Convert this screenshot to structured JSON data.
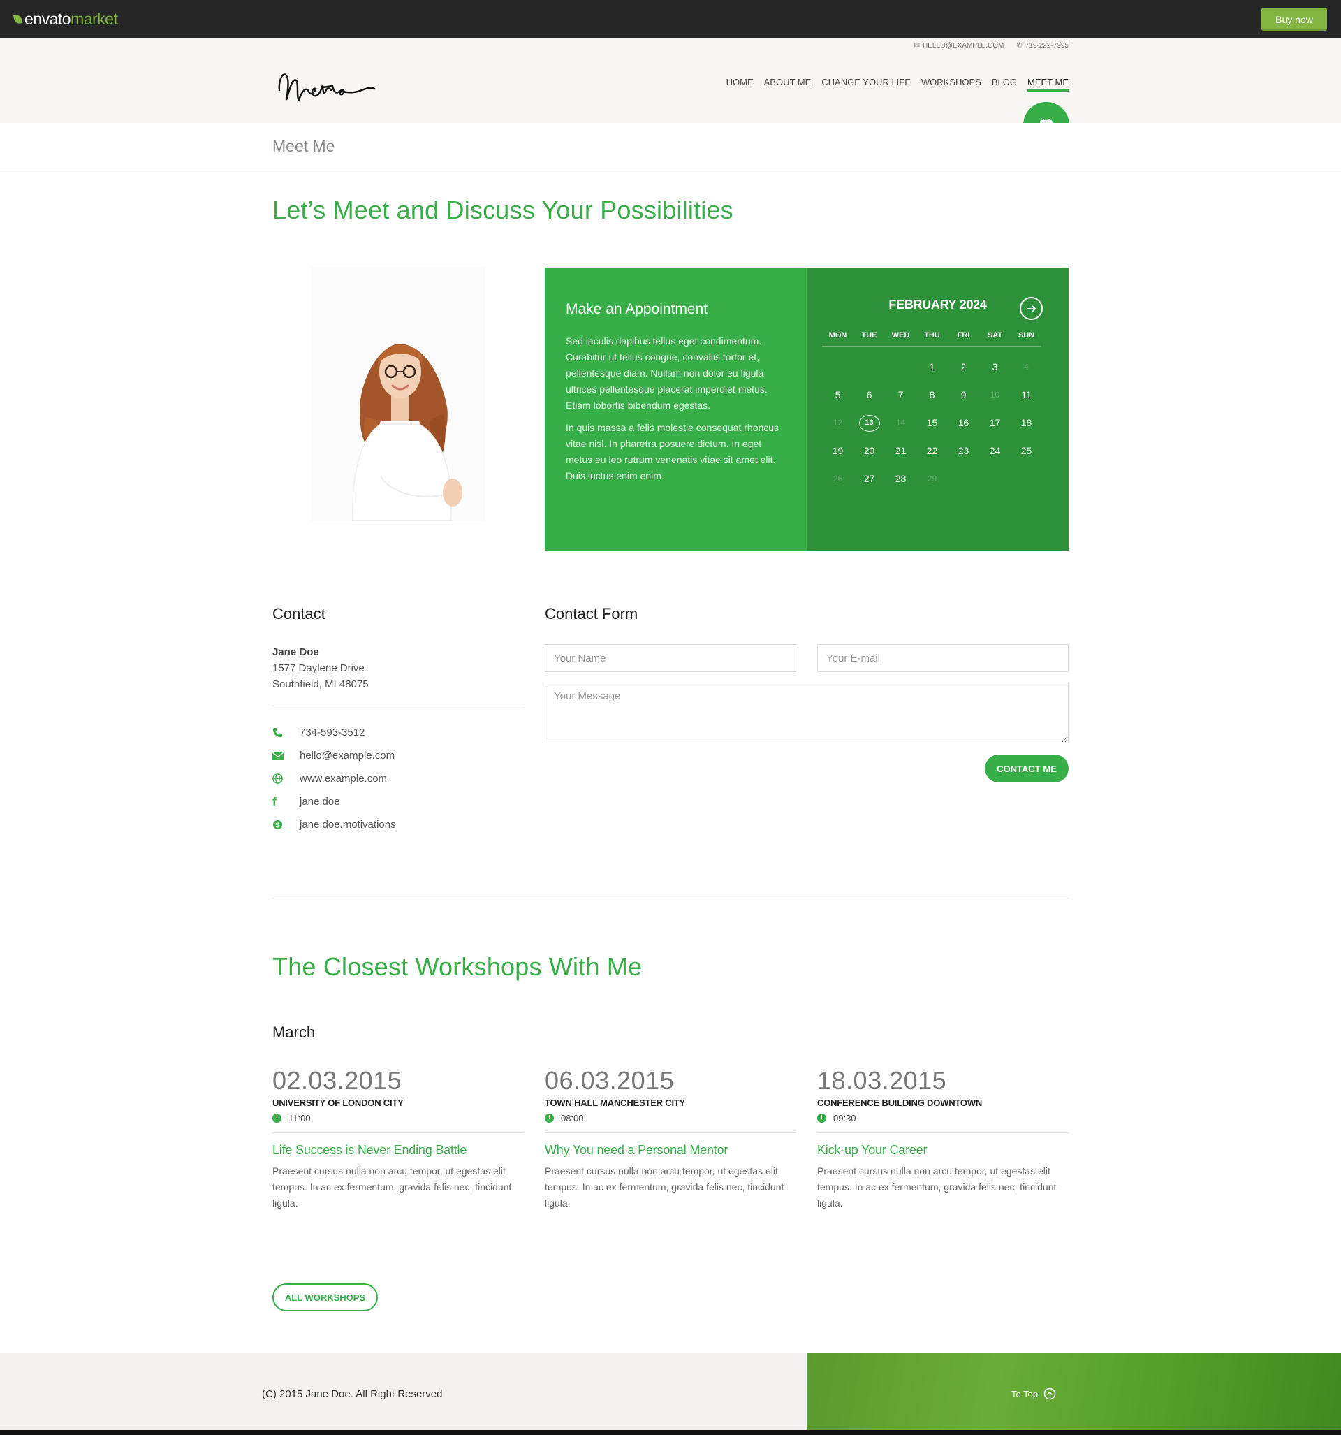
{
  "envato": {
    "logo_main": "envato",
    "logo_sub": "market",
    "buy_now": "Buy now"
  },
  "header": {
    "email": "HELLO@EXAMPLE.COM",
    "phone": "719-222-7995",
    "nav": [
      "HOME",
      "ABOUT ME",
      "CHANGE YOUR LIFE",
      "WORKSHOPS",
      "BLOG",
      "MEET ME"
    ],
    "active_nav": "MEET ME"
  },
  "page_title": "Meet Me",
  "intro_heading": "Let’s Meet and Discuss Your Possibilities",
  "appointment": {
    "title": "Make an Appointment",
    "paragraphs": [
      "Sed iaculis dapibus tellus eget condimentum. Curabitur ut tellus congue, convallis tortor et, pellentesque diam. Nullam non dolor eu ligula ultrices pellentesque placerat imperdiet metus. Etiam lobortis bibendum egestas.",
      "In quis massa a felis molestie consequat rhoncus vitae nisl. In pharetra posuere dictum. In eget metus eu leo rutrum venenatis vitae sit amet elit. Duis luctus enim enim."
    ]
  },
  "calendar": {
    "month": "FEBRUARY 2024",
    "weekdays": [
      "MON",
      "TUE",
      "WED",
      "THU",
      "FRI",
      "SAT",
      "SUN"
    ],
    "weeks": [
      [
        "",
        "",
        "",
        "1",
        "2",
        "3",
        "4"
      ],
      [
        "5",
        "6",
        "7",
        "8",
        "9",
        "10",
        "11"
      ],
      [
        "12",
        "13",
        "14",
        "15",
        "16",
        "17",
        "18"
      ],
      [
        "19",
        "20",
        "21",
        "22",
        "23",
        "24",
        "25"
      ],
      [
        "26",
        "27",
        "28",
        "29",
        "",
        "",
        ""
      ]
    ],
    "dimmed": [
      "4",
      "10",
      "12",
      "14",
      "26",
      "29"
    ],
    "today": "13"
  },
  "contact": {
    "heading": "Contact",
    "name": "Jane Doe",
    "address_line1": "1577 Daylene Drive",
    "address_line2": "Southfield, MI 48075",
    "phone": "734-593-3512",
    "email": "hello@example.com",
    "website": "www.example.com",
    "facebook": "jane.doe",
    "skype": "jane.doe.motivations"
  },
  "contact_form": {
    "heading": "Contact Form",
    "name_placeholder": "Your Name",
    "email_placeholder": "Your E-mail",
    "message_placeholder": "Your Message",
    "submit_label": "CONTACT ME"
  },
  "workshops": {
    "heading": "The Closest Workshops With Me",
    "month": "March",
    "items": [
      {
        "date": "02.03.2015",
        "venue": "UNIVERSITY OF LONDON CITY",
        "time": "11:00",
        "title": "Life Success is Never Ending Battle",
        "desc": "Praesent cursus nulla non arcu tempor, ut egestas elit tempus. In ac ex fermentum, gravida felis nec, tincidunt ligula."
      },
      {
        "date": "06.03.2015",
        "venue": "TOWN HALL MANCHESTER CITY",
        "time": "08:00",
        "title": "Why You need a Personal Mentor",
        "desc": "Praesent cursus nulla non arcu tempor, ut egestas elit tempus. In ac ex fermentum, gravida felis nec, tincidunt ligula."
      },
      {
        "date": "18.03.2015",
        "venue": "CONFERENCE BUILDING DOWNTOWN",
        "time": "09:30",
        "title": "Kick-up Your Career",
        "desc": "Praesent cursus nulla non arcu tempor, ut egestas elit tempus. In ac ex fermentum, gravida felis nec, tincidunt ligula."
      }
    ],
    "all_button": "ALL WORKSHOPS"
  },
  "footer": {
    "copyright": "(C) 2015 Jane Doe. All Right Reserved",
    "to_top": "To Top"
  },
  "colors": {
    "accent": "#37ae47",
    "accent_dark": "#2d9139",
    "envato_green": "#82b541",
    "topbar": "#262626",
    "header_bg": "#f7f6f2"
  },
  "icons": {
    "email": "envelope-icon",
    "phone": "phone-icon",
    "calendar": "calendar-icon",
    "arrow_right": "arrow-right-circle-icon",
    "website": "globe-icon",
    "facebook": "facebook-icon",
    "skype": "skype-icon",
    "clock": "clock-icon",
    "to_top": "chevron-up-circle-icon"
  }
}
